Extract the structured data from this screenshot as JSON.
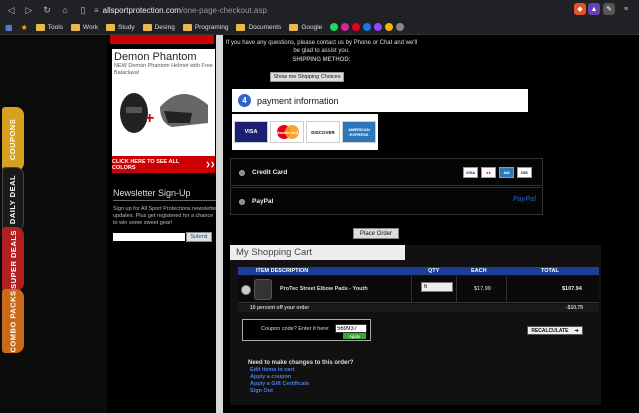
{
  "browser": {
    "url_host": "allsportprotection.com",
    "url_path": "/one-page-checkout.asp",
    "bookmarks": [
      "Tools",
      "Work",
      "Study",
      "Desing",
      "Programing",
      "Documents",
      "Google"
    ]
  },
  "side_tabs": [
    "COUPONS",
    "DAILY DEAL",
    "SUPER DEALS",
    "COMBO PACKS"
  ],
  "sidebar": {
    "promo_title": "Demon Phantom",
    "promo_sub": "NEW Demon Phantom Helmet with Free Balaclava!",
    "promo_button": "CLICK HERE TO SEE ALL COLORS",
    "newsletter_title": "Newsletter Sign-Up",
    "newsletter_text": "Sign up for All Sport Protections newsletter updates. Plus get registered for a chance to win some sweet gear!",
    "submit_label": "Submit"
  },
  "checkout": {
    "help_text": "If you have any questions, please contact us by Phone or Chat and we'll be glad to assist you.",
    "shipping_label": "SHIPPING METHOD:",
    "show_shipping_button": "Show me Shipping Choices",
    "payment_number": "4",
    "payment_title": "payment information",
    "cards": [
      "VISA",
      "MasterCard",
      "DISCOVER",
      "AMERICAN EXPRESS"
    ],
    "options": [
      {
        "label": "Credit Card"
      },
      {
        "label": "PayPal"
      }
    ],
    "paypal_logo": "PayPal",
    "place_order_button": "Place Order"
  },
  "cart": {
    "title": "My Shopping Cart",
    "headers": {
      "item": "ITEM DESCRIPTION",
      "qty": "QTY",
      "each": "EACH",
      "total": "TOTAL"
    },
    "items": [
      {
        "name": "ProTec Street Elbow Pads - Youth",
        "qty": "6",
        "each": "$17.99",
        "total": "$107.94"
      }
    ],
    "discount_label": "10 percent off your order",
    "discount_value": "-$10.79",
    "coupon_label": "Coupon code? Enter it here:",
    "coupon_value": "569937",
    "apply_label": "Apply",
    "recalc_label": "RECALCULATE",
    "change_title": "Need to make changes to this order?",
    "links": [
      "Edit items in cart",
      "Apply a coupon",
      "Apply a Gift Certificate",
      "Sign Out"
    ]
  }
}
